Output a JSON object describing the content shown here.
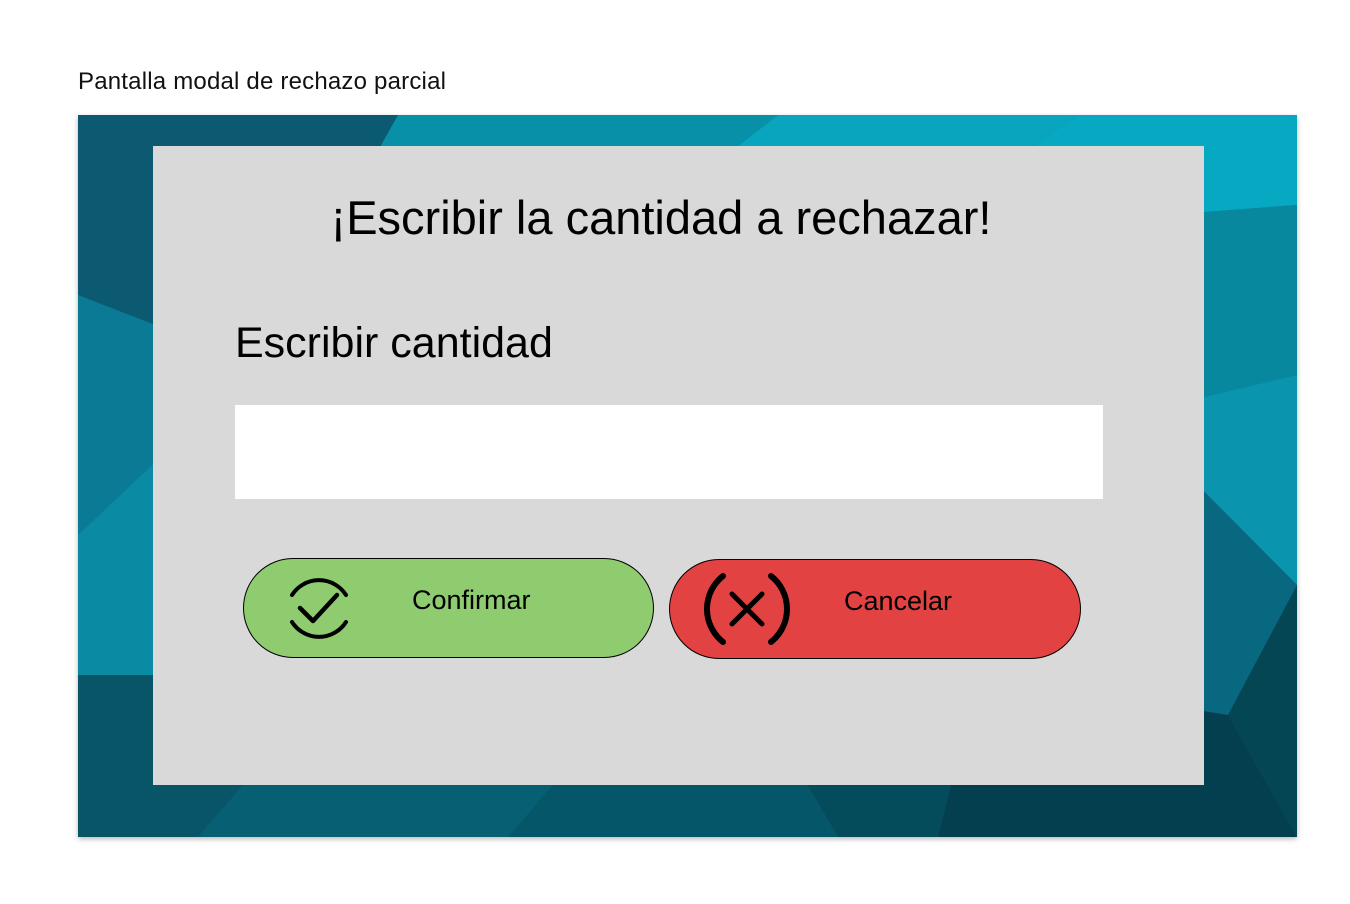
{
  "frame_label": "Pantalla modal de rechazo parcial",
  "modal": {
    "title": "¡Escribir la cantidad a rechazar!",
    "field_label": "Escribir cantidad",
    "field_value": "",
    "confirm": {
      "label": "Confirmar",
      "icon": "check-circle-icon",
      "color": "#8fcb6f"
    },
    "cancel": {
      "label": "Cancelar",
      "icon": "close-circle-icon",
      "color": "#e34242"
    }
  },
  "colors": {
    "background_teal": "#0a7c94",
    "modal_bg": "#d9d9d9"
  }
}
